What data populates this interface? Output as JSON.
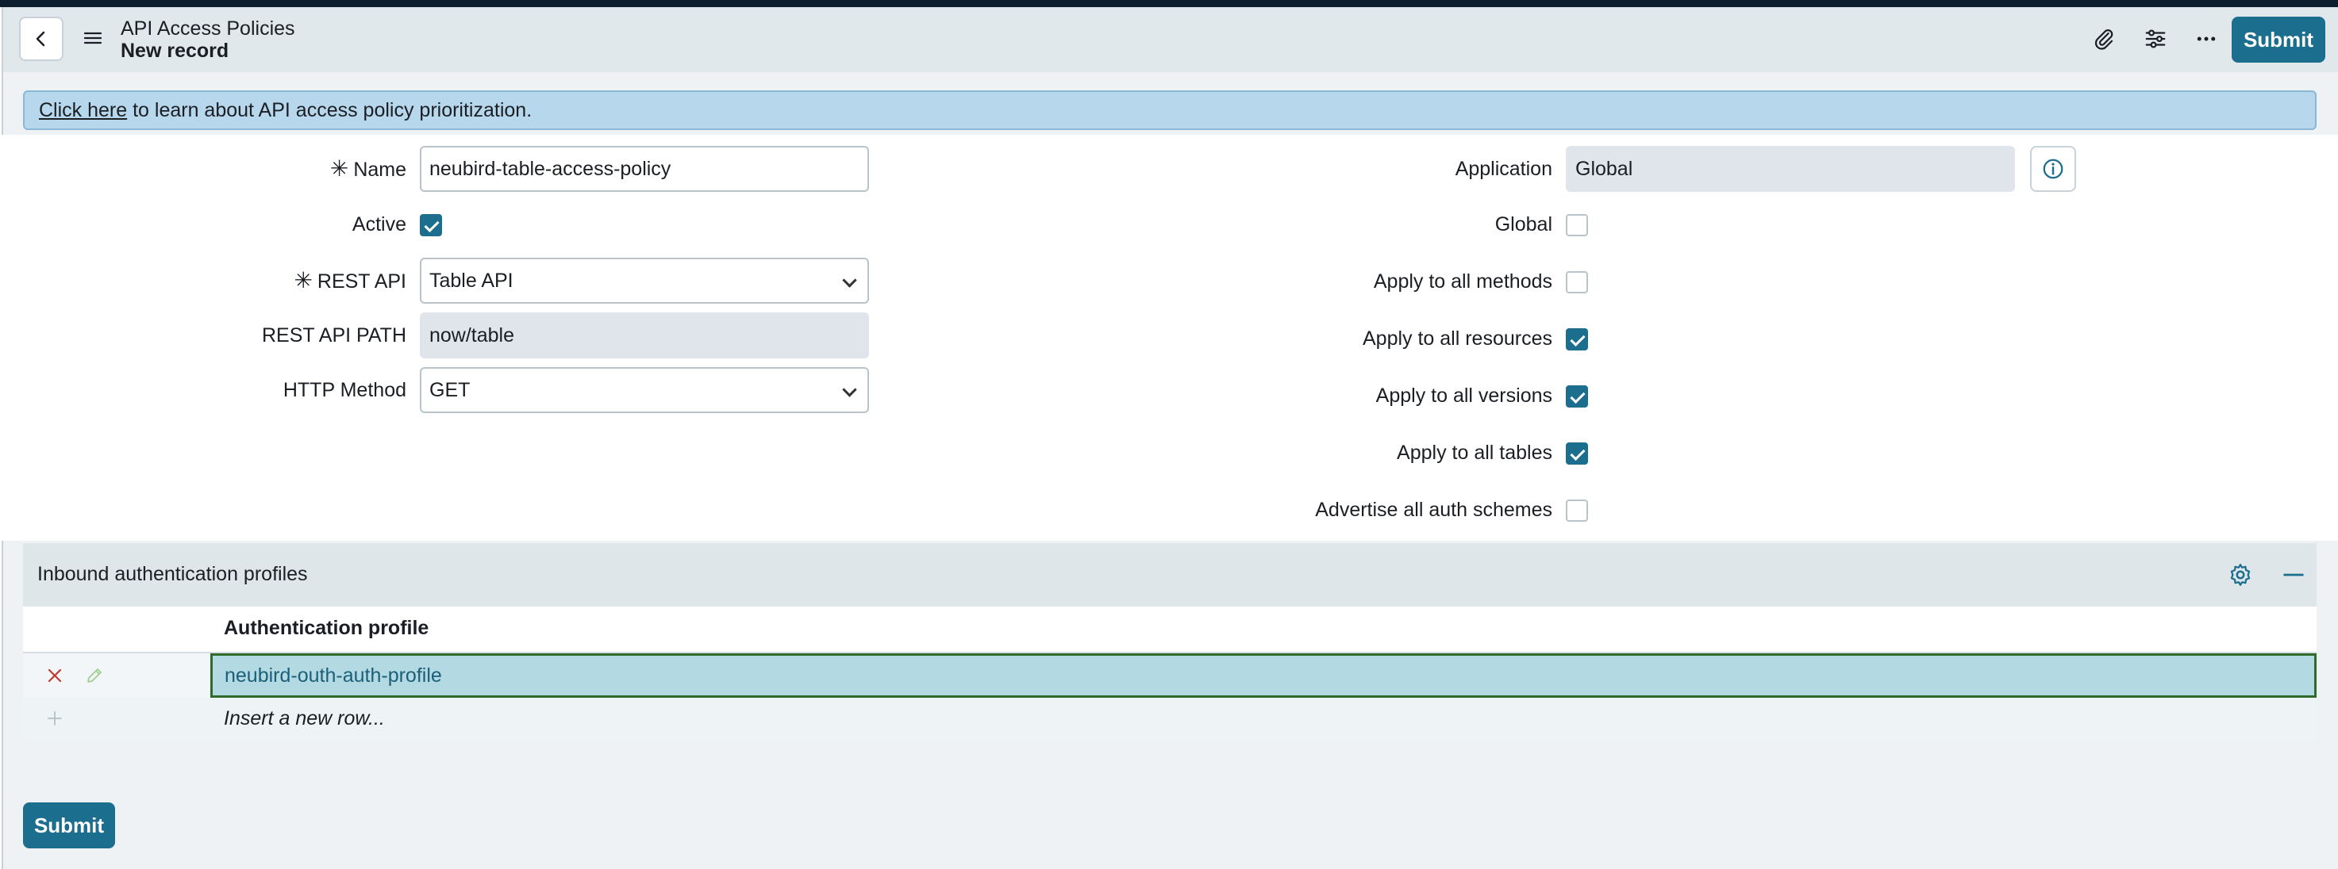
{
  "header": {
    "title": "API Access Policies",
    "subtitle": "New record",
    "submit_label": "Submit"
  },
  "banner": {
    "link_text": "Click here",
    "text": " to learn about API access policy prioritization."
  },
  "form": {
    "name_label": "Name",
    "name_value": "neubird-table-access-policy",
    "active_label": "Active",
    "active_checked": true,
    "rest_api_label": "REST API",
    "rest_api_value": "Table API",
    "rest_api_path_label": "REST API PATH",
    "rest_api_path_value": "now/table",
    "http_method_label": "HTTP Method",
    "http_method_value": "GET",
    "application_label": "Application",
    "application_value": "Global",
    "global_label": "Global",
    "global_checked": false,
    "apply_methods_label": "Apply to all methods",
    "apply_methods_checked": false,
    "apply_resources_label": "Apply to all resources",
    "apply_resources_checked": true,
    "apply_versions_label": "Apply to all versions",
    "apply_versions_checked": true,
    "apply_tables_label": "Apply to all tables",
    "apply_tables_checked": true,
    "advertise_label": "Advertise all auth schemes",
    "advertise_checked": false
  },
  "related_list": {
    "title": "Inbound authentication profiles",
    "column_header": "Authentication profile",
    "rows": [
      {
        "value": "neubird-outh-auth-profile"
      }
    ],
    "insert_text": "Insert a new row..."
  },
  "footer": {
    "submit_label": "Submit"
  },
  "colors": {
    "primary": "#1c6e8f",
    "banner": "#b7d7ec",
    "selected_cell": "#b3d9e3"
  }
}
